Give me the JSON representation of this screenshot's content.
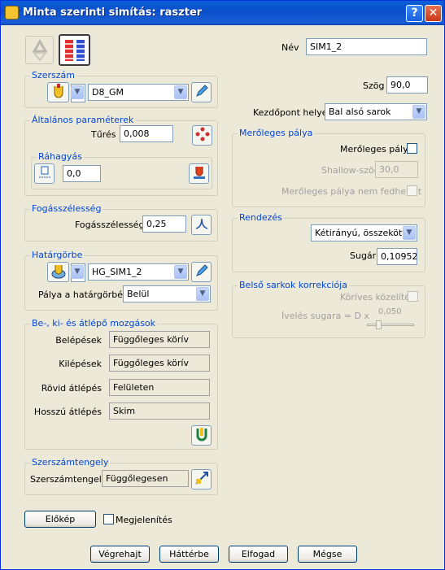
{
  "window": {
    "title": "Minta szerinti simítás: raszter",
    "help_label": "?",
    "close_label": "✕"
  },
  "name": {
    "label": "Név",
    "value": "SIM1_2"
  },
  "angle": {
    "label": "Szög",
    "value": "90,0"
  },
  "start_point": {
    "label": "Kezdőpont helye",
    "value": "Bal alsó sarok"
  },
  "tool": {
    "title": "Szerszám",
    "value": "D8_GM"
  },
  "general": {
    "title": "Általános paraméterek",
    "tolerance_label": "Tűrés",
    "tolerance_value": "0,008"
  },
  "allowance": {
    "title": "Ráhagyás",
    "value": "0,0"
  },
  "perpendicular": {
    "title": "Merőleges pálya",
    "checkbox_label": "Merőleges pálya",
    "shallow_label": "Shallow-szög",
    "shallow_value": "30,0",
    "no_cross_label": "Merőleges pálya nem fedhet át"
  },
  "stepover": {
    "title": "Fogásszélesség",
    "label": "Fogásszélesség",
    "value": "0,25"
  },
  "ordering": {
    "title": "Rendezés",
    "value": "Kétirányú, összekötve",
    "radius_label": "Sugár",
    "radius_value": "0,10952"
  },
  "boundary": {
    "title": "Határgörbe",
    "value": "HG_SIM1_2",
    "path_label": "Pálya a határgörbén",
    "path_value": "Belül"
  },
  "corner": {
    "title": "Belső sarkok korrekciója",
    "arc_label": "Köríves közelítés",
    "radius_label": "Ívelés sugara = D x",
    "slider_value": "0,050"
  },
  "leads": {
    "title": "Be-, ki- és átlépő mozgások",
    "rows": [
      {
        "label": "Belépések",
        "value": "Függőleges körív"
      },
      {
        "label": "Kilépések",
        "value": "Függőleges körív"
      },
      {
        "label": "Rövid átlépés",
        "value": "Felületen"
      },
      {
        "label": "Hosszú átlépés",
        "value": "Skim"
      }
    ]
  },
  "axis": {
    "title": "Szerszámtengely",
    "label": "Szerszámtengely",
    "value": "Függőlegesen"
  },
  "preview": {
    "button_label": "Előkép",
    "display_label": "Megjelenítés"
  },
  "buttons": {
    "execute": "Végrehajt",
    "background": "Háttérbe",
    "accept": "Elfogad",
    "cancel": "Mégse"
  },
  "colors": {
    "titlebar": "#0a4fc9",
    "group_title": "#0046d5",
    "dialog_bg": "#ece9d8"
  }
}
